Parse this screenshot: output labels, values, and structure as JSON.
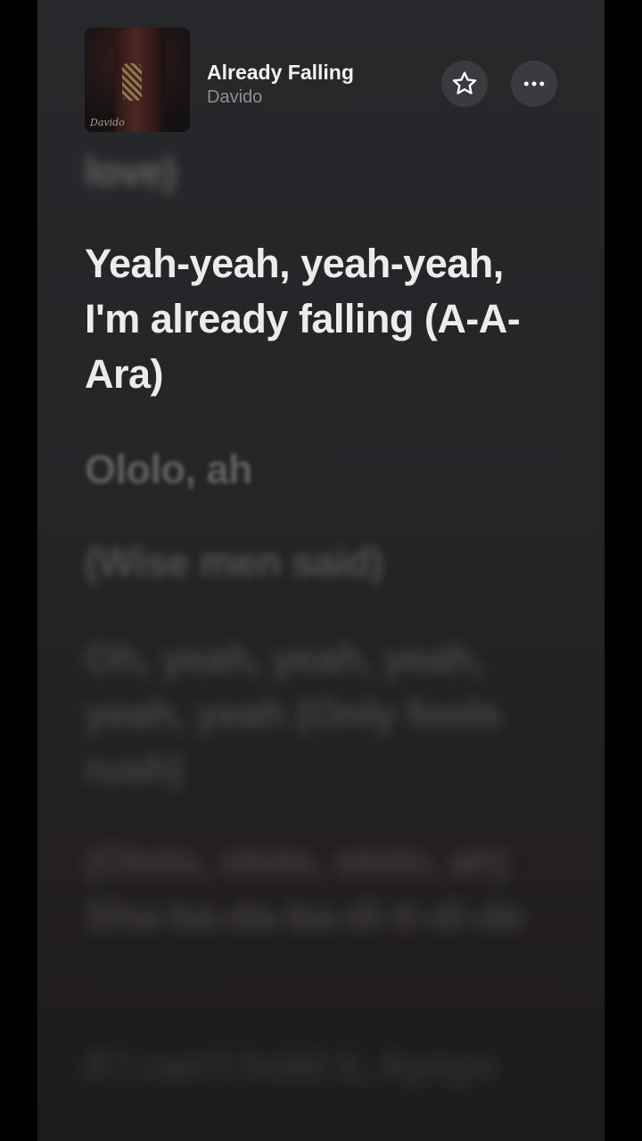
{
  "now_playing": {
    "title": "Already Falling",
    "artist": "Davido",
    "artwork_signature": "Davido"
  },
  "actions": {
    "favorite_icon": "star-icon",
    "more_icon": "ellipsis-icon"
  },
  "lyrics": {
    "previous": "love)",
    "current": "Yeah-yeah, yeah-yeah, I'm already falling (A-A-Ara)",
    "upcoming": [
      "Ololo, ah",
      "(Wise men said)",
      "Oh, yeah, yeah, yeah, yeah, yeah (Only fools rush)",
      "(Ololo, ololo, ololo, ah) Sha-ba-da-ba-di-ti-di-de",
      "If I can't hold it, Ayoyo"
    ]
  },
  "colors": {
    "background": "#262729",
    "active_lyric": "#ececec",
    "artist_text": "#8e8e93",
    "button_bg": "#3a3b3e"
  }
}
